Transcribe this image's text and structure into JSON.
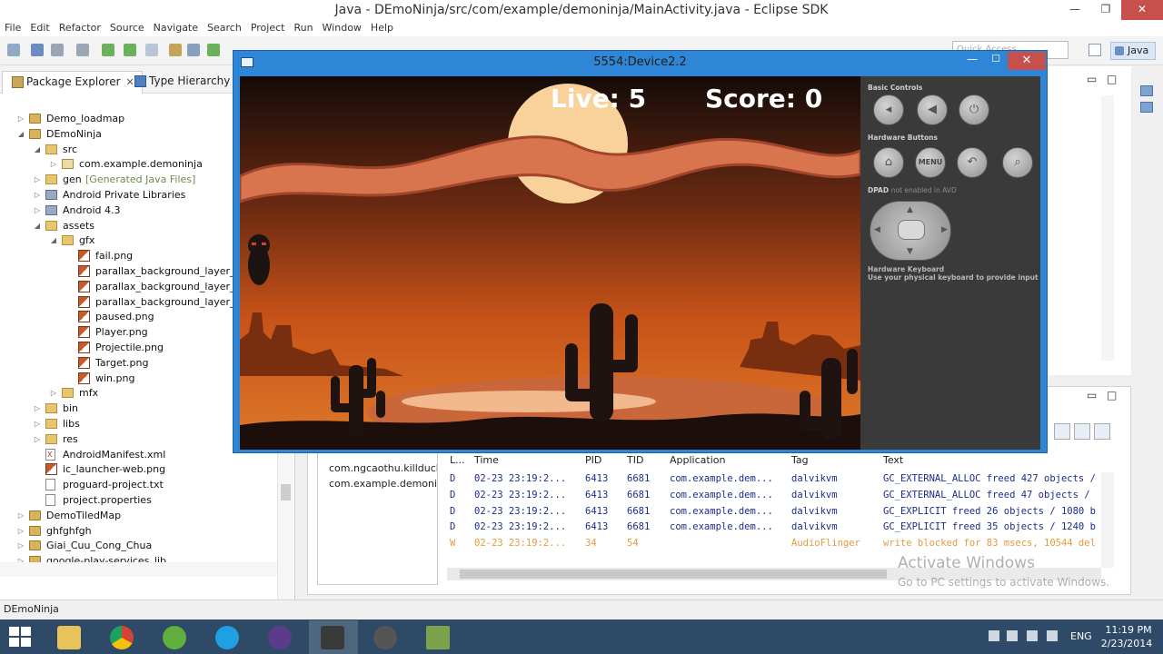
{
  "window": {
    "title": "Java - DEmoNinja/src/com/example/demoninja/MainActivity.java - Eclipse SDK"
  },
  "menu": [
    "File",
    "Edit",
    "Refactor",
    "Source",
    "Navigate",
    "Search",
    "Project",
    "Run",
    "Window",
    "Help"
  ],
  "toolbar": {
    "quick_access": "Quick Access",
    "perspective": "Java"
  },
  "package_explorer": {
    "tab_label": "Package Explorer",
    "close_glyph": "✕",
    "type_hierarchy_label": "Type Hierarchy",
    "tree": [
      {
        "label": "Demo_loadmap",
        "icon": "project-icon",
        "depth": 0,
        "twisty": "▷"
      },
      {
        "label": "DEmoNinja",
        "icon": "project-icon",
        "depth": 0,
        "twisty": "◢"
      },
      {
        "label": "src",
        "icon": "folder-icon",
        "depth": 1,
        "twisty": "◢"
      },
      {
        "label": "com.example.demoninja",
        "icon": "package-icon",
        "depth": 2,
        "twisty": "▷"
      },
      {
        "label": "gen",
        "decoration": "[Generated Java Files]",
        "icon": "folder-icon",
        "depth": 1,
        "twisty": "▷"
      },
      {
        "label": "Android Private Libraries",
        "icon": "library-icon",
        "depth": 1,
        "twisty": "▷"
      },
      {
        "label": "Android 4.3",
        "icon": "library-icon",
        "depth": 1,
        "twisty": "▷"
      },
      {
        "label": "assets",
        "icon": "folder-icon",
        "depth": 1,
        "twisty": "◢"
      },
      {
        "label": "gfx",
        "icon": "folder-icon",
        "depth": 2,
        "twisty": "◢"
      },
      {
        "label": "fail.png",
        "icon": "image-file-icon",
        "depth": 3,
        "twisty": ""
      },
      {
        "label": "parallax_background_layer_back.png",
        "icon": "image-file-icon",
        "depth": 3,
        "twisty": ""
      },
      {
        "label": "parallax_background_layer_front.png",
        "icon": "image-file-icon",
        "depth": 3,
        "twisty": ""
      },
      {
        "label": "parallax_background_layer_mid.png",
        "icon": "image-file-icon",
        "depth": 3,
        "twisty": ""
      },
      {
        "label": "paused.png",
        "icon": "image-file-icon",
        "depth": 3,
        "twisty": ""
      },
      {
        "label": "Player.png",
        "icon": "image-file-icon",
        "depth": 3,
        "twisty": ""
      },
      {
        "label": "Projectile.png",
        "icon": "image-file-icon",
        "depth": 3,
        "twisty": ""
      },
      {
        "label": "Target.png",
        "icon": "image-file-icon",
        "depth": 3,
        "twisty": ""
      },
      {
        "label": "win.png",
        "icon": "image-file-icon",
        "depth": 3,
        "twisty": ""
      },
      {
        "label": "mfx",
        "icon": "folder-icon",
        "depth": 2,
        "twisty": "▷"
      },
      {
        "label": "bin",
        "icon": "folder-icon",
        "depth": 1,
        "twisty": "▷"
      },
      {
        "label": "libs",
        "icon": "folder-icon",
        "depth": 1,
        "twisty": "▷"
      },
      {
        "label": "res",
        "icon": "folder-icon",
        "depth": 1,
        "twisty": "▷"
      },
      {
        "label": "AndroidManifest.xml",
        "icon": "xml-file-icon",
        "depth": 1,
        "twisty": ""
      },
      {
        "label": "ic_launcher-web.png",
        "icon": "image-file-icon",
        "depth": 1,
        "twisty": ""
      },
      {
        "label": "proguard-project.txt",
        "icon": "text-file-icon",
        "depth": 1,
        "twisty": ""
      },
      {
        "label": "project.properties",
        "icon": "text-file-icon",
        "depth": 1,
        "twisty": ""
      },
      {
        "label": "DemoTiledMap",
        "icon": "project-icon",
        "depth": 0,
        "twisty": "▷"
      },
      {
        "label": "ghfghfgh",
        "icon": "project-icon",
        "depth": 0,
        "twisty": "▷"
      },
      {
        "label": "Giai_Cuu_Cong_Chua",
        "icon": "project-icon",
        "depth": 0,
        "twisty": "▷"
      },
      {
        "label": "google-play-services_lib",
        "icon": "project-icon",
        "depth": 0,
        "twisty": "▷"
      }
    ]
  },
  "status_bar": {
    "text": "DEmoNinja"
  },
  "emulator": {
    "title": "5554:Device2.2",
    "hud": {
      "live": "Live: 5",
      "score": "Score:  0"
    },
    "controls": {
      "basic_controls": "Basic Controls",
      "hardware_buttons": "Hardware Buttons",
      "dpad_label": "DPAD",
      "dpad_note": "not enabled in AVD",
      "keyboard_title": "Hardware Keyboard",
      "keyboard_text": "Use your physical keyboard to provide input",
      "menu_label": "MENU"
    }
  },
  "logcat": {
    "apps": [
      "com.ngcaothu.killduck",
      "com.example.demoninja"
    ],
    "headers": [
      "L...",
      "Time",
      "PID",
      "TID",
      "Application",
      "Tag",
      "Text"
    ],
    "rows": [
      [
        "D",
        "02-23 23:19:2...",
        "6413",
        "6681",
        "com.example.dem...",
        "dalvikvm",
        "GC_EXTERNAL_ALLOC freed 427 objects /"
      ],
      [
        "D",
        "02-23 23:19:2...",
        "6413",
        "6681",
        "com.example.dem...",
        "dalvikvm",
        "GC_EXTERNAL_ALLOC freed 47 objects /"
      ],
      [
        "D",
        "02-23 23:19:2...",
        "6413",
        "6681",
        "com.example.dem...",
        "dalvikvm",
        "GC_EXPLICIT freed 26 objects / 1080 b"
      ],
      [
        "D",
        "02-23 23:19:2...",
        "6413",
        "6681",
        "com.example.dem...",
        "dalvikvm",
        "GC_EXPLICIT freed 35 objects / 1240 b"
      ],
      [
        "W",
        "02-23 23:19:2...",
        "34",
        "54",
        "",
        "AudioFlinger",
        "write blocked for 83 msecs, 10544 del"
      ]
    ]
  },
  "watermark": {
    "title": "Activate Windows",
    "subtitle": "Go to PC settings to activate Windows."
  },
  "taskbar": {
    "language": "ENG",
    "time": "11:19 PM",
    "date": "2/23/2014"
  },
  "colors": {
    "emulator_border": "#2f86d6",
    "close_button": "#c7504c",
    "taskbar": "#2e4a66",
    "log_debug": "#1c2c8c",
    "log_warn": "#e59a3c"
  }
}
